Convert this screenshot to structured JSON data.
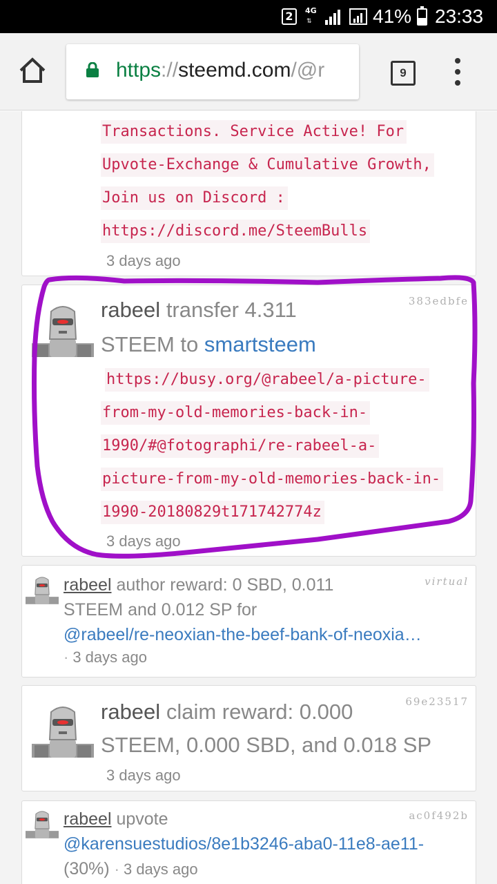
{
  "status_bar": {
    "sim_slot": "2",
    "network": "4G",
    "battery_percent": "41%",
    "battery_level": 0.41,
    "clock": "23:33"
  },
  "browser": {
    "url_scheme": "https",
    "url_separator": "://",
    "url_host": "steemd.com",
    "url_path": "/@r",
    "tab_count": "9",
    "colors": {
      "secure": "#0b8043"
    }
  },
  "feed": {
    "colors": {
      "link": "#3a7bbf",
      "memo_text": "#c7254e",
      "memo_bg": "#f9f2f4",
      "annotation": "#a010c8"
    },
    "card1": {
      "memo_lines": [
        "Transactions. Service Active! For",
        "Upvote-Exchange & Cumulative Growth,",
        "Join us on Discord :",
        "https://discord.me/SteemBulls"
      ],
      "time": "3 days ago"
    },
    "card2": {
      "hash": "383edbfe",
      "user": "rabeel",
      "action": "transfer 4.311",
      "line2_prefix": "STEEM to",
      "recipient": "smartsteem",
      "memo_lines": [
        "https://busy.org/@rabeel/a-picture-",
        "from-my-old-memories-back-in-",
        "1990/#@fotographi/re-rabeel-a-",
        "picture-from-my-old-memories-back-in-",
        "1990-20180829t171742774z"
      ],
      "time": "3 days ago"
    },
    "card3": {
      "hash": "virtual",
      "user": "rabeel",
      "action": "author reward: 0 SBD, 0.011",
      "line2": "STEEM and 0.012 SP for",
      "permlink": "@rabeel/re-neoxian-the-beef-bank-of-neoxia…",
      "dot": "·",
      "time": "3 days ago"
    },
    "card4": {
      "hash": "69e23517",
      "user": "rabeel",
      "action": "claim reward: 0.000",
      "line2": "STEEM, 0.000 SBD, and 0.018 SP",
      "time": "3 days ago"
    },
    "card5": {
      "hash": "ac0f492b",
      "user": "rabeel",
      "action": "upvote",
      "permlink": "@karensuestudios/8e1b3246-aba0-11e8-ae11-",
      "weight": "(30%)",
      "dot": "·",
      "time": "3 days ago"
    }
  }
}
